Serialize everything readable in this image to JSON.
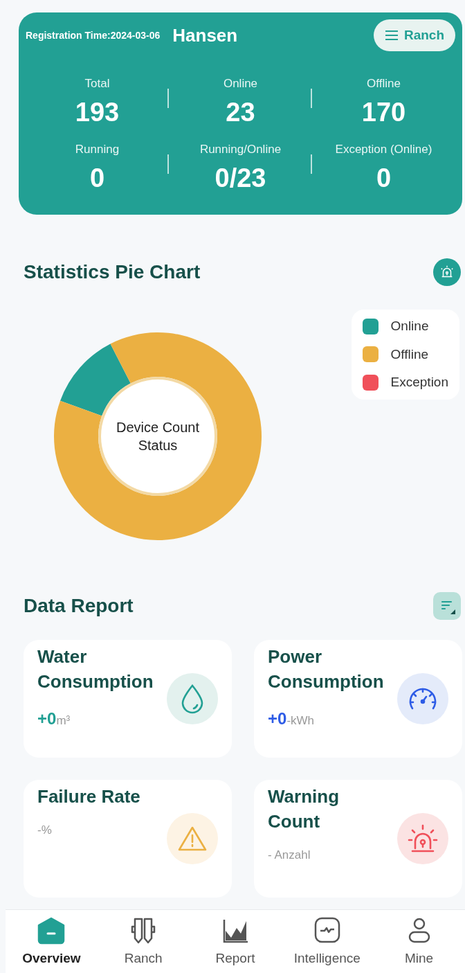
{
  "header": {
    "registration": "Registration Time:2024-03-06",
    "name": "Hansen",
    "ranch_button": "Ranch",
    "stats": [
      {
        "label": "Total",
        "value": "193"
      },
      {
        "label": "Online",
        "value": "23"
      },
      {
        "label": "Offline",
        "value": "170"
      },
      {
        "label": "Running",
        "value": "0"
      },
      {
        "label": "Running/Online",
        "value": "0/23"
      },
      {
        "label": "Exception (Online)",
        "value": "0"
      }
    ]
  },
  "statistics": {
    "title": "Statistics Pie Chart",
    "center_label": "Device Count Status",
    "chart_data": {
      "type": "donut",
      "categories": [
        "Online",
        "Offline",
        "Exception"
      ],
      "values": [
        11.9,
        88.1,
        0
      ],
      "colors": [
        "#22a094",
        "#ebb042",
        "#f0505a"
      ]
    }
  },
  "report": {
    "title": "Data Report",
    "cards": [
      {
        "kind": "water",
        "title": "Water Consumption",
        "value": "+0",
        "unit": "m³"
      },
      {
        "kind": "power",
        "title": "Power Consumption",
        "value": "+0",
        "unit": "-kWh"
      },
      {
        "kind": "failure",
        "title": "Failure Rate",
        "value": "-",
        "unit": "%"
      },
      {
        "kind": "warning",
        "title": "Warning Count",
        "value": "-",
        "unit": " Anzahl"
      }
    ]
  },
  "nav": [
    {
      "label": "Overview",
      "selected": true
    },
    {
      "label": "Ranch",
      "selected": false
    },
    {
      "label": "Report",
      "selected": false
    },
    {
      "label": "Intelligence",
      "selected": false
    },
    {
      "label": "Mine",
      "selected": false
    }
  ]
}
